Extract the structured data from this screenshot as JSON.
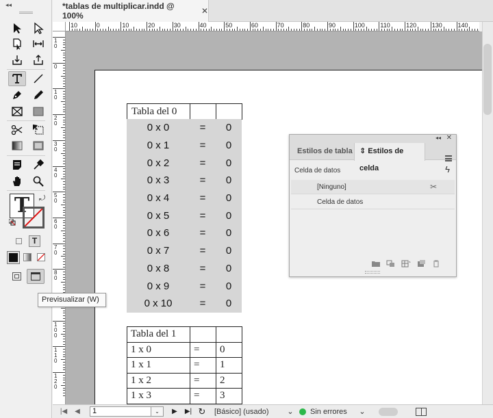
{
  "tabs": {
    "document_title": "*tablas de multiplicar.indd @ 100%",
    "close_glyph": "✕"
  },
  "tools": {
    "collapse_glyph": "◂◂",
    "big_type_glyph": "T",
    "small_type_glyph": "T",
    "items": [
      "selection-tool",
      "direct-selection-tool",
      "page-tool",
      "gap-tool",
      "content-collector-tool",
      "content-placer-tool",
      "type-tool",
      "line-tool",
      "pen-tool",
      "pencil-tool",
      "rectangle-frame-tool",
      "rectangle-tool",
      "scissors-tool",
      "free-transform-tool",
      "gradient-swatch-tool",
      "gradient-feather-tool",
      "note-tool",
      "eyedropper-tool",
      "hand-tool",
      "zoom-tool"
    ]
  },
  "ruler": {
    "h_labels": [
      "10",
      "0",
      "10",
      "20",
      "30",
      "40",
      "50",
      "60",
      "70",
      "80",
      "90",
      "100",
      "110",
      "120",
      "130",
      "140"
    ],
    "v_labels": [
      "1\n0",
      "0",
      "1\n0",
      "2\n0",
      "3\n0",
      "4\n0",
      "5\n0",
      "6\n0",
      "7\n0",
      "8\n0",
      "9\n0",
      "1\n0\n0",
      "1\n1\n0",
      "1\n2\n0"
    ]
  },
  "table0": {
    "title": "Tabla del 0",
    "rows": [
      [
        "0 x 0",
        "=",
        "0"
      ],
      [
        "0 x 1",
        "=",
        "0"
      ],
      [
        "0 x 2",
        "=",
        "0"
      ],
      [
        "0 x 3",
        "=",
        "0"
      ],
      [
        "0 x 4",
        "=",
        "0"
      ],
      [
        "0 x 5",
        "=",
        "0"
      ],
      [
        "0 x 6",
        "=",
        "0"
      ],
      [
        "0 x 7",
        "=",
        "0"
      ],
      [
        "0 x 8",
        "=",
        "0"
      ],
      [
        "0 x 9",
        "=",
        "0"
      ],
      [
        "0 x 10",
        "=",
        "0"
      ]
    ]
  },
  "table1": {
    "title": "Tabla del 1",
    "rows": [
      [
        "1 x 0",
        "=",
        "0"
      ],
      [
        "1 x 1",
        "=",
        "1"
      ],
      [
        "1 x 2",
        "=",
        "2"
      ],
      [
        "1 x 3",
        "=",
        "3"
      ]
    ]
  },
  "panel": {
    "collapse_glyph": "◂◂",
    "close_glyph": "✕",
    "tab_table_styles": "Estilos de tabla",
    "tab_cell_styles": "⇕ Estilos de celda",
    "current_style": "Celda de datos",
    "bolt_glyph": "ϟ",
    "items": [
      "[Ninguno]",
      "Celda de datos"
    ],
    "pin_glyph": "✂",
    "footer_icons": [
      "new-group-icon",
      "load-styles-icon",
      "new-style-icon",
      "duplicate-icon",
      "delete-icon"
    ]
  },
  "tooltip": {
    "text": "Previsualizar (W)"
  },
  "status": {
    "page_number": "1",
    "style_label": "[Básico] (usado)",
    "errors_label": "Sin errores",
    "ok_color": "#2db84a",
    "dropdown_glyph": "⌄"
  },
  "colors": {
    "pasteboard": "#b3b3b3",
    "table_fill": "#d6d6d6",
    "page": "#ffffff"
  }
}
